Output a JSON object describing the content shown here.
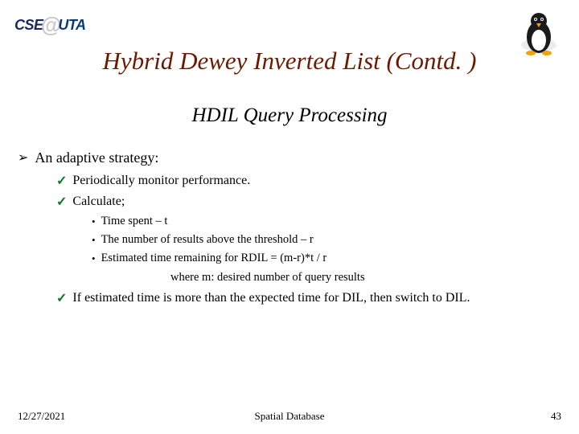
{
  "logo": {
    "left_cse": "CSE",
    "left_at": "@",
    "left_uta": "UTA"
  },
  "title": "Hybrid Dewey Inverted List (Contd. )",
  "subtitle": "HDIL Query Processing",
  "bullets": {
    "lvl1_1": "An adaptive strategy:",
    "lvl2_1": "Periodically monitor performance.",
    "lvl2_2": "Calculate;",
    "lvl3_1": "Time spent – t",
    "lvl3_2": "The number of results above the threshold – r",
    "lvl3_3": "Estimated time remaining for RDIL = (m-r)*t / r",
    "where": "where m: desired number of query results",
    "lvl2_3": "If estimated time is more than the expected time for DIL, then switch to DIL."
  },
  "footer": {
    "date": "12/27/2021",
    "label": "Spatial Database",
    "page": "43"
  }
}
